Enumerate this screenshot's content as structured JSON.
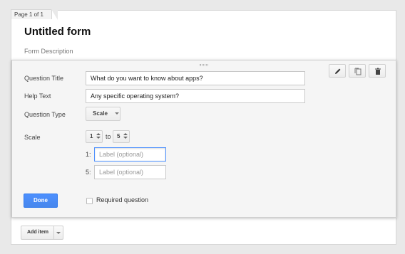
{
  "page_tab": "Page 1 of 1",
  "form": {
    "title": "Untitled form",
    "description_placeholder": "Form Description"
  },
  "question": {
    "title_label": "Question Title",
    "title_value": "What do you want to know about apps?",
    "help_label": "Help Text",
    "help_value": "Any specific operating system?",
    "type_label": "Question Type",
    "type_value": "Scale",
    "scale_label": "Scale",
    "scale_min": "1",
    "scale_to": "to",
    "scale_max": "5",
    "min_index": "1:",
    "max_index": "5:",
    "min_label_placeholder": "Label (optional)",
    "max_label_placeholder": "Label (optional)"
  },
  "toolbar": {
    "icons": [
      "pencil-icon",
      "duplicate-icon",
      "trash-icon"
    ]
  },
  "actions": {
    "done_label": "Done",
    "required_label": "Required question",
    "add_item_label": "Add item"
  },
  "colors": {
    "accent": "#4d90fe",
    "page_bg": "#e9e9e9",
    "card_bg": "#f5f5f5"
  }
}
